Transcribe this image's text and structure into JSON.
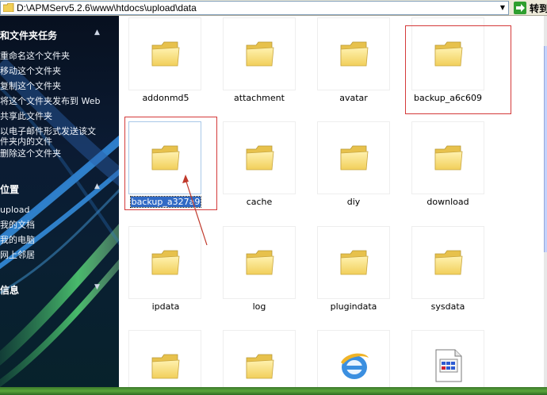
{
  "address_bar": {
    "path": "D:\\APMServ5.2.6\\www\\htdocs\\upload\\data",
    "go_label": "转到"
  },
  "task_pane": {
    "sections": [
      {
        "title": "和文件夹任务",
        "items": [
          "重命名这个文件夹",
          "移动这个文件夹",
          "复制这个文件夹",
          "将这个文件夹发布到 Web",
          "共享此文件夹",
          "以电子邮件形式发送该文",
          "件夹内的文件",
          "删除这个文件夹"
        ]
      },
      {
        "title": "位置",
        "items": [
          "upload",
          "我的文档",
          "我的电脑",
          "网上邻居"
        ]
      },
      {
        "title": "信息",
        "items": []
      }
    ]
  },
  "files": [
    {
      "name": "addonmd5",
      "icon": "folder-icon"
    },
    {
      "name": "attachment",
      "icon": "folder-icon"
    },
    {
      "name": "avatar",
      "icon": "folder-icon"
    },
    {
      "name": "backup_a6c609",
      "icon": "folder-icon"
    },
    {
      "name": "backup_a327a9",
      "icon": "folder-icon"
    },
    {
      "name": "cache",
      "icon": "folder-icon"
    },
    {
      "name": "diy",
      "icon": "folder-icon"
    },
    {
      "name": "download",
      "icon": "folder-icon"
    },
    {
      "name": "ipdata",
      "icon": "folder-icon"
    },
    {
      "name": "log",
      "icon": "folder-icon"
    },
    {
      "name": "plugindata",
      "icon": "folder-icon"
    },
    {
      "name": "sysdata",
      "icon": "folder-icon"
    },
    {
      "name": "",
      "icon": "folder-icon"
    },
    {
      "name": "",
      "icon": "folder-icon"
    },
    {
      "name": "",
      "icon": "internet-explorer-icon"
    },
    {
      "name": "",
      "icon": "document-icon"
    }
  ],
  "colors": {
    "selection": "#316ac5",
    "annotation_red": "#d43a3a",
    "folder_yellow": "#f5d86a"
  }
}
